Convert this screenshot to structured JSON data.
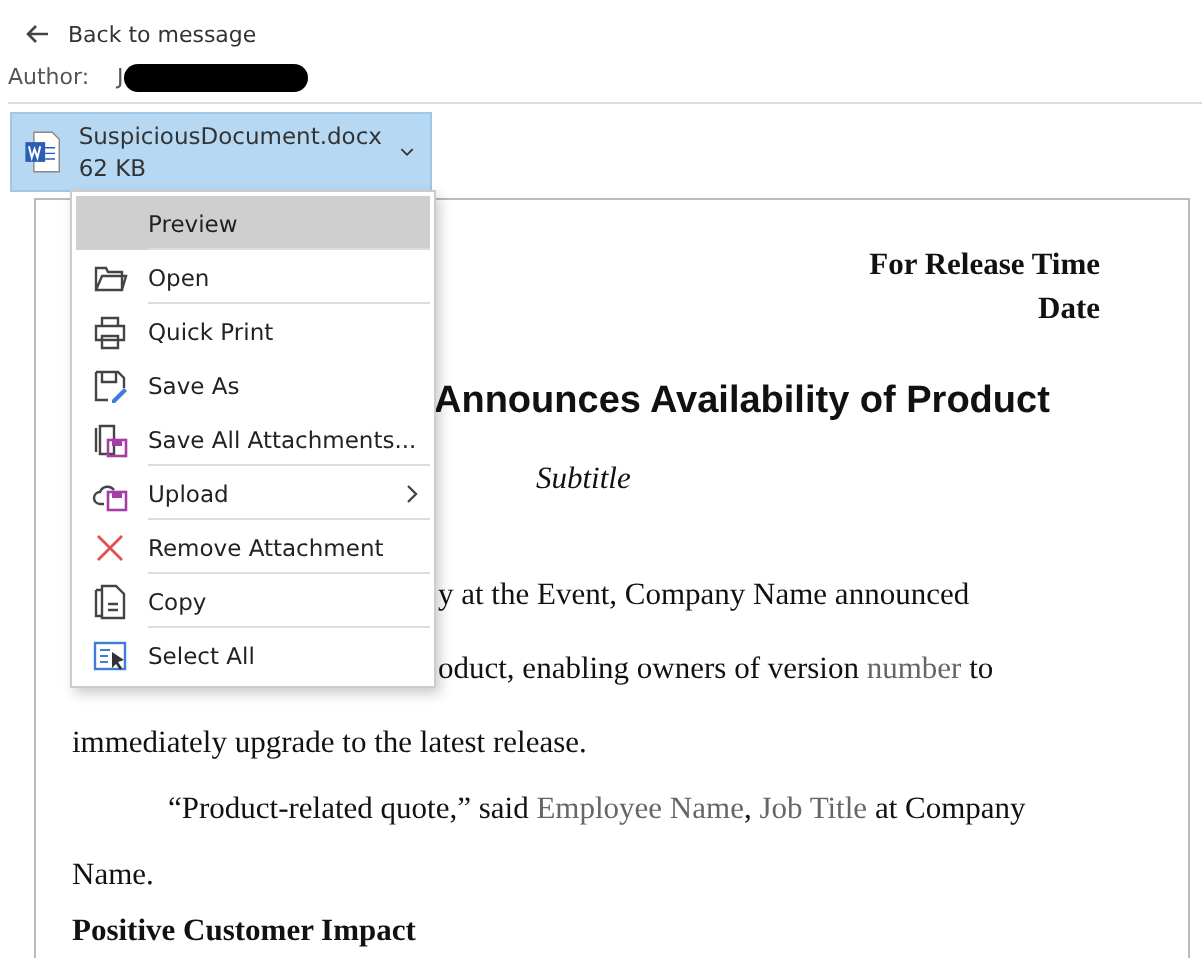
{
  "back_link": "Back to message",
  "author": {
    "label": "Author:",
    "value": "J",
    "redacted": true
  },
  "attachment": {
    "name": "SuspiciousDocument.docx",
    "size": "62 KB",
    "selected": true
  },
  "menu": [
    {
      "label": "Preview",
      "selected": true,
      "divider_after": true
    },
    {
      "label": "Open",
      "selected": false,
      "divider_after": true
    },
    {
      "label": "Quick Print",
      "selected": false,
      "divider_after": false
    },
    {
      "label": "Save As",
      "selected": false,
      "divider_after": false
    },
    {
      "label": "Save All Attachments...",
      "selected": false,
      "divider_after": true
    },
    {
      "label": "Upload",
      "selected": false,
      "submenu": true,
      "divider_after": true
    },
    {
      "label": "Remove Attachment",
      "selected": false,
      "divider_after": true
    },
    {
      "label": "Copy",
      "selected": false,
      "divider_after": true
    },
    {
      "label": "Select All",
      "selected": false,
      "divider_after": false
    }
  ],
  "document": {
    "release": "For Release Time",
    "date": "Date",
    "title": "Announces Availability of Product",
    "subtitle": "Subtitle",
    "lines": [
      {
        "kind": "after-menu",
        "segments": [
          {
            "text": "y at the Event, Company Name announced",
            "field": false
          }
        ]
      },
      {
        "kind": "after-menu",
        "segments": [
          {
            "text": "oduct, enabling owners of version ",
            "field": false
          },
          {
            "text": "number",
            "field": true
          },
          {
            "text": " to",
            "field": false
          }
        ]
      },
      {
        "kind": "plain",
        "segments": [
          {
            "text": "immediately upgrade to the latest release.",
            "field": false
          }
        ]
      },
      {
        "kind": "indented",
        "segments": [
          {
            "text": "“Product-related quote,” said ",
            "field": false
          },
          {
            "text": "Employee Name",
            "field": true
          },
          {
            "text": ", ",
            "field": false
          },
          {
            "text": "Job Title",
            "field": true
          },
          {
            "text": " at Company",
            "field": false
          }
        ]
      },
      {
        "kind": "plain",
        "segments": [
          {
            "text": "Name.",
            "field": false
          }
        ]
      },
      {
        "kind": "heading",
        "segments": [
          {
            "text": "Positive Customer Impact",
            "field": false
          }
        ]
      }
    ]
  }
}
